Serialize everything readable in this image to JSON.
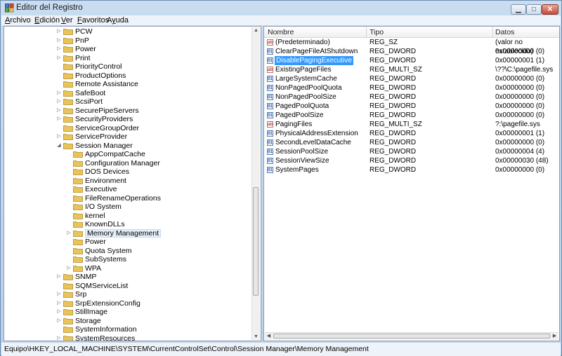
{
  "window": {
    "title": "Editor del Registro"
  },
  "menu": [
    {
      "label": "Archivo",
      "key": "A",
      "rest": "rchivo"
    },
    {
      "label": "Edición",
      "key": "E",
      "rest": "dición"
    },
    {
      "label": "Ver",
      "key": "V",
      "rest": "er"
    },
    {
      "label": "Favoritos",
      "key": "F",
      "rest": "avoritos"
    },
    {
      "label": "Ayuda",
      "key": "y",
      "pre": "A",
      "rest": "uda"
    }
  ],
  "tree": [
    {
      "label": "PCW",
      "level": 0,
      "expander": true
    },
    {
      "label": "PnP",
      "level": 0,
      "expander": true
    },
    {
      "label": "Power",
      "level": 0,
      "expander": true
    },
    {
      "label": "Print",
      "level": 0,
      "expander": true
    },
    {
      "label": "PriorityControl",
      "level": 0,
      "expander": false
    },
    {
      "label": "ProductOptions",
      "level": 0,
      "expander": false
    },
    {
      "label": "Remote Assistance",
      "level": 0,
      "expander": false
    },
    {
      "label": "SafeBoot",
      "level": 0,
      "expander": true
    },
    {
      "label": "ScsiPort",
      "level": 0,
      "expander": true
    },
    {
      "label": "SecurePipeServers",
      "level": 0,
      "expander": true
    },
    {
      "label": "SecurityProviders",
      "level": 0,
      "expander": true
    },
    {
      "label": "ServiceGroupOrder",
      "level": 0,
      "expander": false
    },
    {
      "label": "ServiceProvider",
      "level": 0,
      "expander": true
    },
    {
      "label": "Session Manager",
      "level": 0,
      "expander": "open"
    },
    {
      "label": "AppCompatCache",
      "level": 1,
      "expander": false
    },
    {
      "label": "Configuration Manager",
      "level": 1,
      "expander": false
    },
    {
      "label": "DOS Devices",
      "level": 1,
      "expander": false
    },
    {
      "label": "Environment",
      "level": 1,
      "expander": false
    },
    {
      "label": "Executive",
      "level": 1,
      "expander": false
    },
    {
      "label": "FileRenameOperations",
      "level": 1,
      "expander": false
    },
    {
      "label": "I/O System",
      "level": 1,
      "expander": false
    },
    {
      "label": "kernel",
      "level": 1,
      "expander": false
    },
    {
      "label": "KnownDLLs",
      "level": 1,
      "expander": false
    },
    {
      "label": "Memory Management",
      "level": 1,
      "expander": true,
      "selected": true
    },
    {
      "label": "Power",
      "level": 1,
      "expander": false
    },
    {
      "label": "Quota System",
      "level": 1,
      "expander": false
    },
    {
      "label": "SubSystems",
      "level": 1,
      "expander": false
    },
    {
      "label": "WPA",
      "level": 1,
      "expander": true
    },
    {
      "label": "SNMP",
      "level": 0,
      "expander": true
    },
    {
      "label": "SQMServiceList",
      "level": 0,
      "expander": false
    },
    {
      "label": "Srp",
      "level": 0,
      "expander": true
    },
    {
      "label": "SrpExtensionConfig",
      "level": 0,
      "expander": true
    },
    {
      "label": "StillImage",
      "level": 0,
      "expander": true
    },
    {
      "label": "Storage",
      "level": 0,
      "expander": true
    },
    {
      "label": "SystemInformation",
      "level": 0,
      "expander": false
    },
    {
      "label": "SystemResources",
      "level": 0,
      "expander": true
    }
  ],
  "list": {
    "headers": [
      "Nombre",
      "Tipo",
      "Datos"
    ],
    "rows": [
      {
        "name": "(Predeterminado)",
        "type": "REG_SZ",
        "data": "(valor no establecido)",
        "icon": "string-value-icon"
      },
      {
        "name": "ClearPageFileAtShutdown",
        "type": "REG_DWORD",
        "data": "0x00000000 (0)",
        "icon": "binary-value-icon"
      },
      {
        "name": "DisablePagingExecutive",
        "type": "REG_DWORD",
        "data": "0x00000001 (1)",
        "icon": "binary-value-icon",
        "selected": true
      },
      {
        "name": "ExistingPageFiles",
        "type": "REG_MULTI_SZ",
        "data": "\\??\\C:\\pagefile.sys",
        "icon": "string-value-icon"
      },
      {
        "name": "LargeSystemCache",
        "type": "REG_DWORD",
        "data": "0x00000000 (0)",
        "icon": "binary-value-icon"
      },
      {
        "name": "NonPagedPoolQuota",
        "type": "REG_DWORD",
        "data": "0x00000000 (0)",
        "icon": "binary-value-icon"
      },
      {
        "name": "NonPagedPoolSize",
        "type": "REG_DWORD",
        "data": "0x00000000 (0)",
        "icon": "binary-value-icon"
      },
      {
        "name": "PagedPoolQuota",
        "type": "REG_DWORD",
        "data": "0x00000000 (0)",
        "icon": "binary-value-icon"
      },
      {
        "name": "PagedPoolSize",
        "type": "REG_DWORD",
        "data": "0x00000000 (0)",
        "icon": "binary-value-icon"
      },
      {
        "name": "PagingFiles",
        "type": "REG_MULTI_SZ",
        "data": "?:\\pagefile.sys",
        "icon": "string-value-icon"
      },
      {
        "name": "PhysicalAddressExtension",
        "type": "REG_DWORD",
        "data": "0x00000001 (1)",
        "icon": "binary-value-icon"
      },
      {
        "name": "SecondLevelDataCache",
        "type": "REG_DWORD",
        "data": "0x00000000 (0)",
        "icon": "binary-value-icon"
      },
      {
        "name": "SessionPoolSize",
        "type": "REG_DWORD",
        "data": "0x00000004 (4)",
        "icon": "binary-value-icon"
      },
      {
        "name": "SessionViewSize",
        "type": "REG_DWORD",
        "data": "0x00000030 (48)",
        "icon": "binary-value-icon"
      },
      {
        "name": "SystemPages",
        "type": "REG_DWORD",
        "data": "0x00000000 (0)",
        "icon": "binary-value-icon"
      }
    ]
  },
  "status": {
    "path": "Equipo\\HKEY_LOCAL_MACHINE\\SYSTEM\\CurrentControlSet\\Control\\Session Manager\\Memory Management"
  },
  "colors": {
    "selection": "#3399ff",
    "folder": "#e8c45a",
    "chrome": "#c9dcf0"
  }
}
